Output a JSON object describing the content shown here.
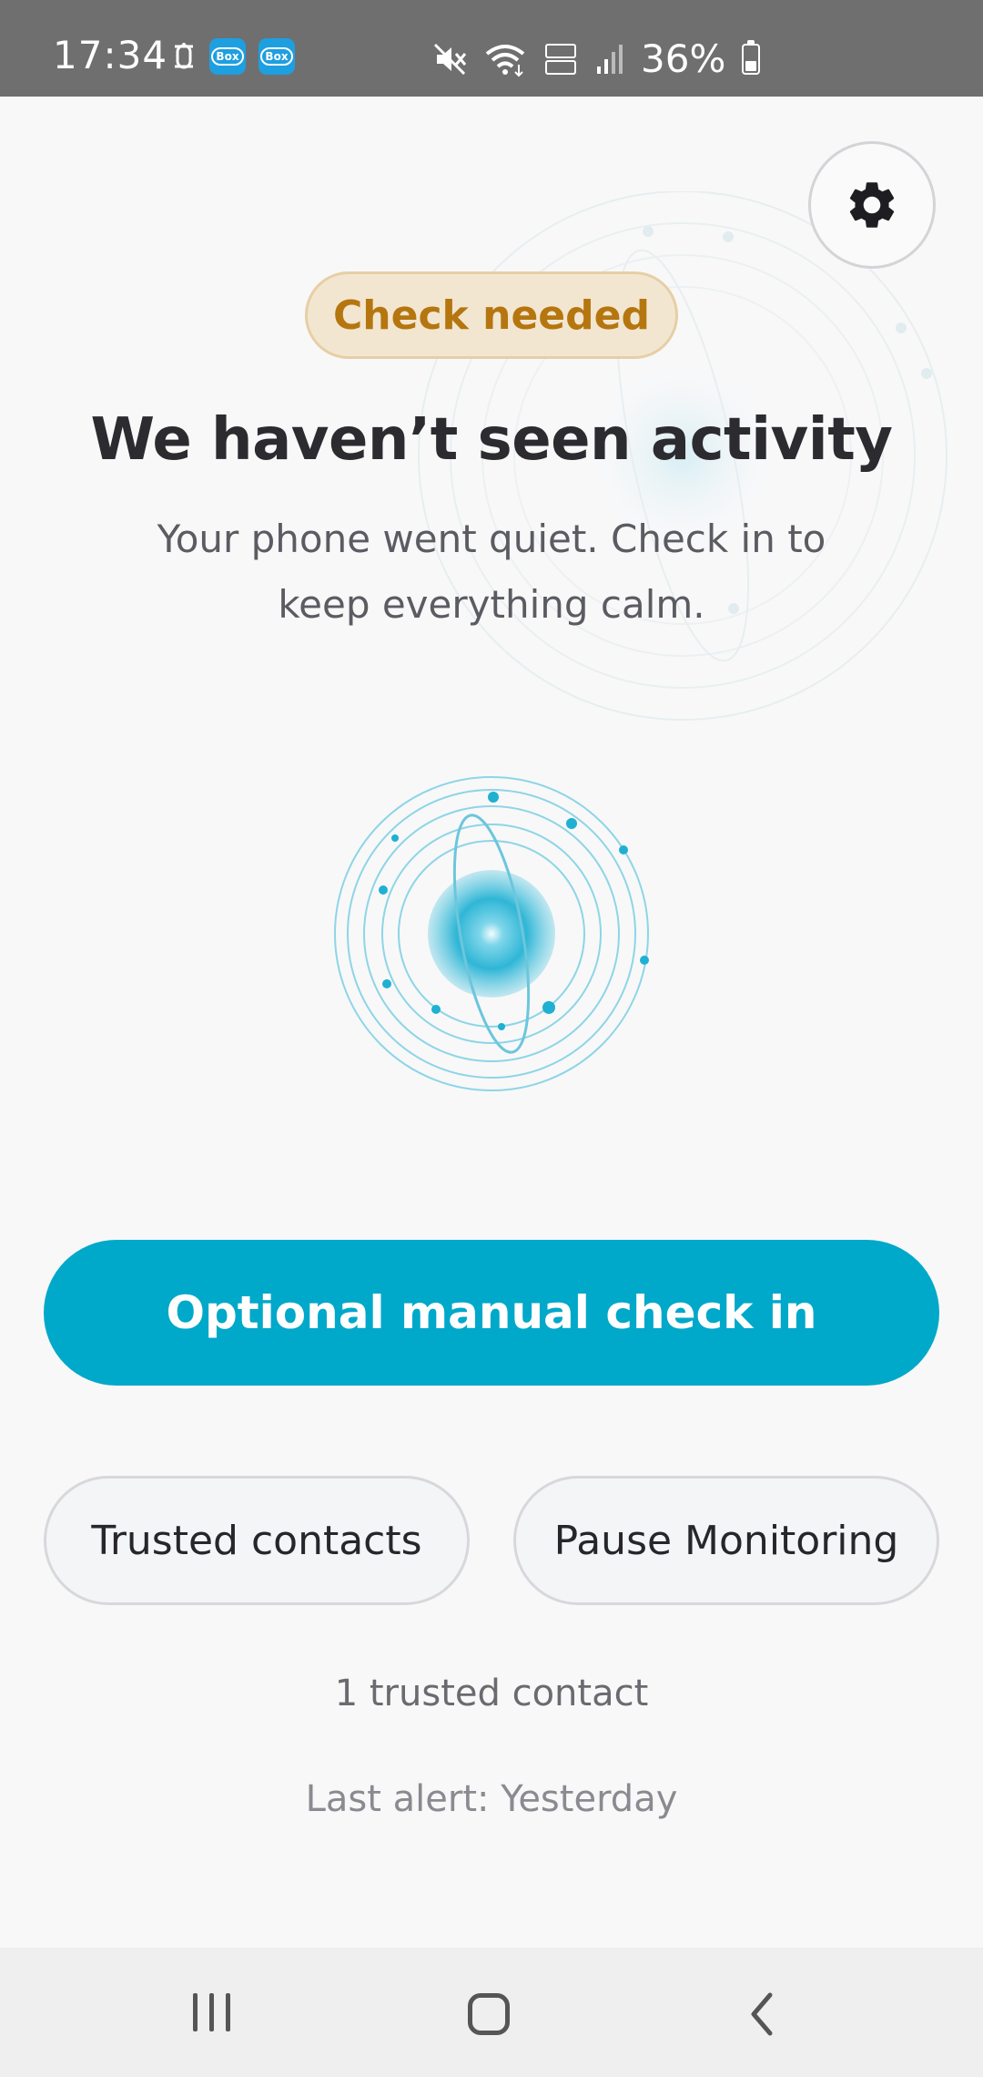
{
  "status_bar": {
    "time": "17:34",
    "app_icon_label": "Box",
    "battery_text": "36%",
    "battery_level": 0.36,
    "icons": [
      "sim-icon",
      "box-app-icon",
      "box-app-icon",
      "mute-icon",
      "wifi-icon",
      "volte-icon",
      "signal-icon",
      "battery-icon"
    ]
  },
  "header": {
    "settings_icon": "gear-icon"
  },
  "status": {
    "badge": "Check needed",
    "title": "We haven’t seen activity",
    "subtitle": "Your phone went quiet. Check in to keep everything calm."
  },
  "actions": {
    "primary": "Optional manual check in",
    "trusted_contacts": "Trusted contacts",
    "pause_monitoring": "Pause Monitoring"
  },
  "info": {
    "contacts_count": "1 trusted contact",
    "last_alert": "Last alert: Yesterday"
  },
  "colors": {
    "accent": "#00a8c9",
    "badge_bg": "#f3e6d1",
    "badge_text": "#b5760f",
    "background": "#f8f8f9"
  },
  "navbar": {
    "icons": [
      "recents-icon",
      "home-icon",
      "back-icon"
    ]
  }
}
